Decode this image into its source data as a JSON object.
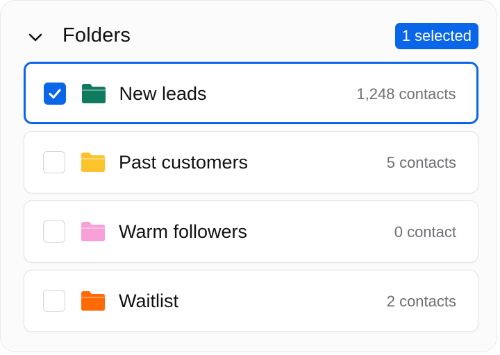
{
  "header": {
    "title": "Folders",
    "selected_badge": "1 selected",
    "toggle_icon": "chevron-down-icon"
  },
  "folders": [
    {
      "name": "New leads",
      "count": "1,248 contacts",
      "color": "#0e7a5e",
      "selected": true
    },
    {
      "name": "Past customers",
      "count": "5 contacts",
      "color": "#fcc32c",
      "selected": false
    },
    {
      "name": "Warm followers",
      "count": "0 contact",
      "color": "#f9a0d8",
      "selected": false
    },
    {
      "name": "Waitlist",
      "count": "2 contacts",
      "color": "#ff6a07",
      "selected": false
    }
  ],
  "colors": {
    "accent": "#0a66e8",
    "text": "#111114",
    "muted": "#6e6e74"
  }
}
